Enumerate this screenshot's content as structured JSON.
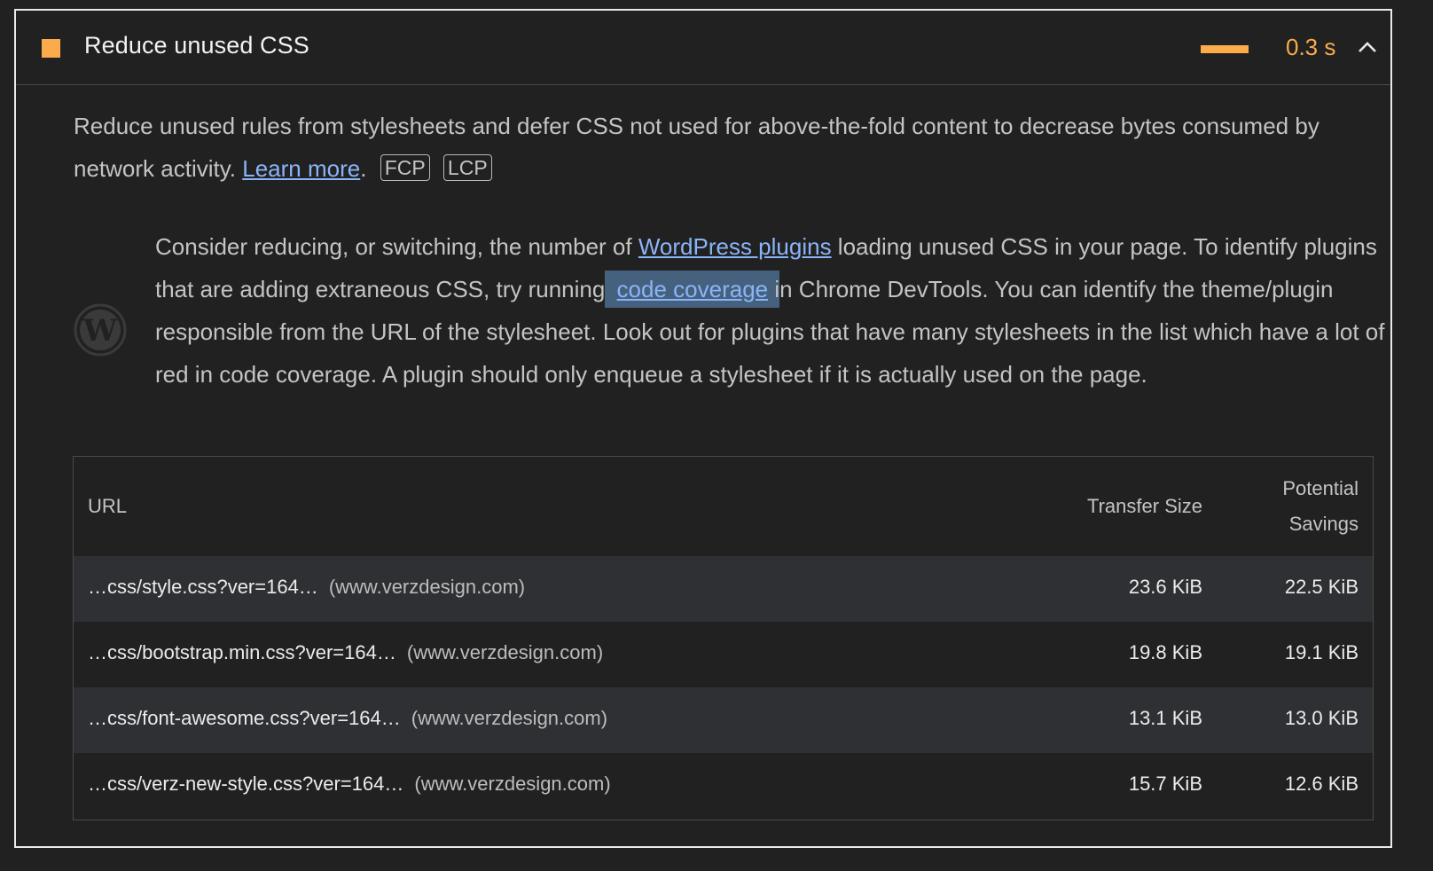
{
  "audit": {
    "title": "Reduce unused CSS",
    "savings_display": "0.3 s",
    "status_color": "#fbaa4c"
  },
  "description": {
    "text": "Reduce unused rules from stylesheets and defer CSS not used for above-the-fold content to decrease bytes consumed by network activity. ",
    "learn_more": "Learn more",
    "period": ".",
    "tags": [
      "FCP",
      "LCP"
    ]
  },
  "stack_pack": {
    "icon": "wordpress-icon",
    "part1": "Consider reducing, or switching, the number of ",
    "link1": "WordPress plugins",
    "part2": " loading unused CSS in your page. To identify plugins that are adding extraneous CSS, try running",
    "link2": "code coverage",
    "part3_highlighted": " i",
    "part3": "n Chrome DevTools. You can identify the theme/plugin responsible from the URL of the stylesheet. Look out for plugins that have many stylesheets in the list which have a lot of red in code coverage. A plugin should only enqueue a stylesheet if it is actually used on the page."
  },
  "table": {
    "headers": {
      "url": "URL",
      "transfer_size": "Transfer Size",
      "potential_savings_line1": "Potential",
      "potential_savings_line2": "Savings"
    },
    "rows": [
      {
        "url": "…css/style.css?ver=164…",
        "host": "(www.verzdesign.com)",
        "transfer_size": "23.6 KiB",
        "savings": "22.5 KiB"
      },
      {
        "url": "…css/bootstrap.min.css?ver=164…",
        "host": "(www.verzdesign.com)",
        "transfer_size": "19.8 KiB",
        "savings": "19.1 KiB"
      },
      {
        "url": "…css/font-awesome.css?ver=164…",
        "host": "(www.verzdesign.com)",
        "transfer_size": "13.1 KiB",
        "savings": "13.0 KiB"
      },
      {
        "url": "…css/verz-new-style.css?ver=164…",
        "host": "(www.verzdesign.com)",
        "transfer_size": "15.7 KiB",
        "savings": "12.6 KiB"
      }
    ]
  }
}
